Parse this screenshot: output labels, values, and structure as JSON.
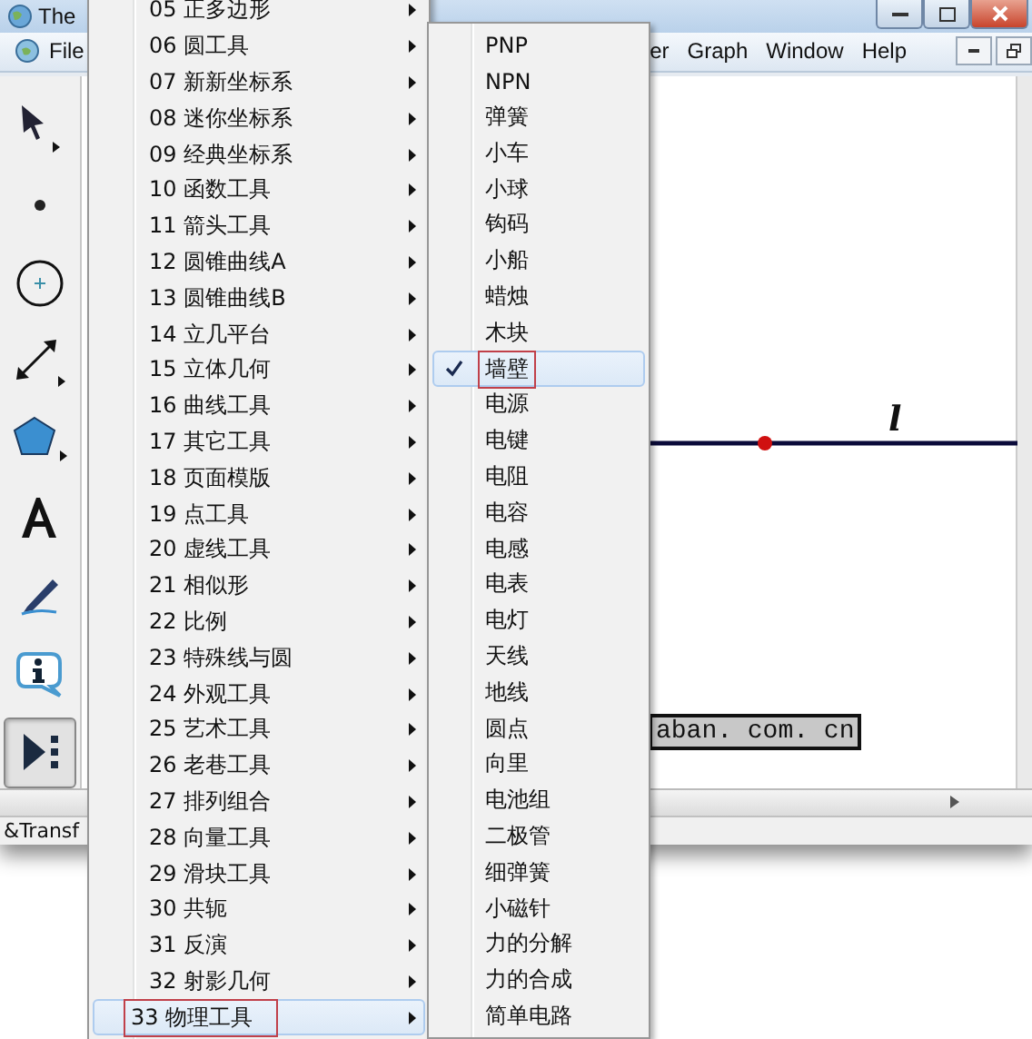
{
  "window": {
    "title": "The"
  },
  "menubar": [
    {
      "label": "File"
    },
    {
      "label": "er"
    },
    {
      "label": "Graph"
    },
    {
      "label": "Window"
    },
    {
      "label": "Help"
    }
  ],
  "toolbar": [
    {
      "kind": "arrow",
      "selected": false
    },
    {
      "kind": "point",
      "selected": false
    },
    {
      "kind": "compass",
      "selected": false
    },
    {
      "kind": "line",
      "selected": false
    },
    {
      "kind": "polygon",
      "selected": false
    },
    {
      "kind": "text",
      "selected": false
    },
    {
      "kind": "marker",
      "selected": false
    },
    {
      "kind": "info",
      "selected": false
    },
    {
      "kind": "custom",
      "selected": true
    }
  ],
  "canvas": {
    "line_label": "l",
    "text_box": "aban. com. cn"
  },
  "status_bar": "&Transf",
  "menu": {
    "items": [
      {
        "label": "05 正多边形",
        "selected": false
      },
      {
        "label": "06 圆工具",
        "selected": false
      },
      {
        "label": "07 新新坐标系",
        "selected": false
      },
      {
        "label": "08 迷你坐标系",
        "selected": false
      },
      {
        "label": "09 经典坐标系",
        "selected": false
      },
      {
        "label": "10 函数工具",
        "selected": false
      },
      {
        "label": "11 箭头工具",
        "selected": false
      },
      {
        "label": "12 圆锥曲线A",
        "selected": false
      },
      {
        "label": "13 圆锥曲线B",
        "selected": false
      },
      {
        "label": "14 立几平台",
        "selected": false
      },
      {
        "label": "15 立体几何",
        "selected": false
      },
      {
        "label": "16 曲线工具",
        "selected": false
      },
      {
        "label": "17 其它工具",
        "selected": false
      },
      {
        "label": "18 页面模版",
        "selected": false
      },
      {
        "label": "19 点工具",
        "selected": false
      },
      {
        "label": "20 虚线工具",
        "selected": false
      },
      {
        "label": "21 相似形",
        "selected": false
      },
      {
        "label": "22 比例",
        "selected": false
      },
      {
        "label": "23 特殊线与圆",
        "selected": false
      },
      {
        "label": "24 外观工具",
        "selected": false
      },
      {
        "label": "25 艺术工具",
        "selected": false
      },
      {
        "label": "26 老巷工具",
        "selected": false
      },
      {
        "label": "27 排列组合",
        "selected": false
      },
      {
        "label": "28 向量工具",
        "selected": false
      },
      {
        "label": "29 滑块工具",
        "selected": false
      },
      {
        "label": "30 共轭",
        "selected": false
      },
      {
        "label": "31 反演",
        "selected": false
      },
      {
        "label": "32 射影几何",
        "selected": false
      },
      {
        "label": "33 物理工具",
        "selected": true
      }
    ]
  },
  "submenu": {
    "items": [
      {
        "label": "PNP",
        "checked": false
      },
      {
        "label": "NPN",
        "checked": false
      },
      {
        "label": "弹簧",
        "checked": false
      },
      {
        "label": "小车",
        "checked": false
      },
      {
        "label": "小球",
        "checked": false
      },
      {
        "label": "钩码",
        "checked": false
      },
      {
        "label": "小船",
        "checked": false
      },
      {
        "label": "蜡烛",
        "checked": false
      },
      {
        "label": "木块",
        "checked": false
      },
      {
        "label": "墙壁",
        "checked": true
      },
      {
        "label": "电源",
        "checked": false
      },
      {
        "label": "电键",
        "checked": false
      },
      {
        "label": "电阻",
        "checked": false
      },
      {
        "label": "电容",
        "checked": false
      },
      {
        "label": "电感",
        "checked": false
      },
      {
        "label": "电表",
        "checked": false
      },
      {
        "label": "电灯",
        "checked": false
      },
      {
        "label": "天线",
        "checked": false
      },
      {
        "label": "地线",
        "checked": false
      },
      {
        "label": "圆点",
        "checked": false
      },
      {
        "label": "向里",
        "checked": false
      },
      {
        "label": "电池组",
        "checked": false
      },
      {
        "label": "二极管",
        "checked": false
      },
      {
        "label": "细弹簧",
        "checked": false
      },
      {
        "label": "小磁针",
        "checked": false
      },
      {
        "label": "力的分解",
        "checked": false
      },
      {
        "label": "力的合成",
        "checked": false
      },
      {
        "label": "简单电路",
        "checked": false
      }
    ]
  }
}
